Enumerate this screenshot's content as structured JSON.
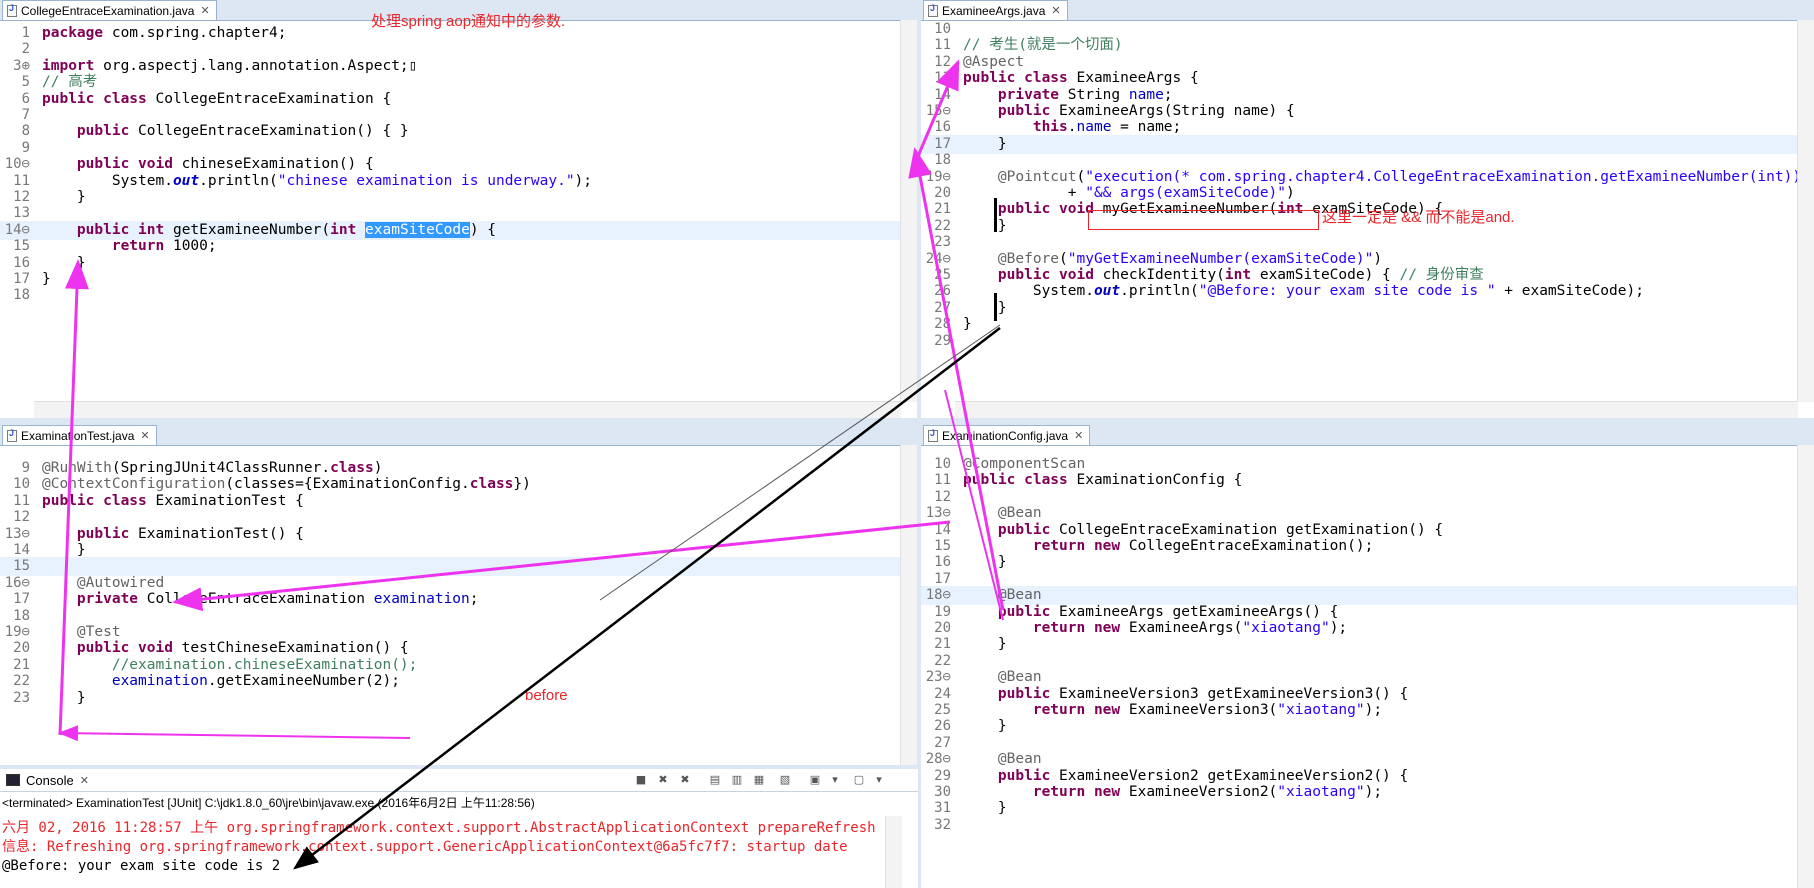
{
  "editors": {
    "college": {
      "tab": "CollegeEntraceExamination.java",
      "lines": [
        {
          "n": "1",
          "h": "<span class='kw'>package</span> com.spring.chapter4;"
        },
        {
          "n": "2",
          "h": ""
        },
        {
          "n": "3⊕",
          "h": "<span class='kw'>import</span> org.aspectj.lang.annotation.Aspect;▯"
        },
        {
          "n": "5",
          "h": "<span class='cm'>// 高考</span>"
        },
        {
          "n": "6",
          "h": "<span class='kw'>public class</span> CollegeEntraceExamination {"
        },
        {
          "n": "7",
          "h": ""
        },
        {
          "n": "8",
          "h": "    <span class='kw'>public</span> CollegeEntraceExamination() { }"
        },
        {
          "n": "9",
          "h": ""
        },
        {
          "n": "10⊖",
          "h": "    <span class='kw'>public void</span> chineseExamination() {"
        },
        {
          "n": "11",
          "h": "        System.<span class='sfld'>out</span>.println(<span class='str'>\"chinese examination is underway.\"</span>);"
        },
        {
          "n": "12",
          "h": "    }"
        },
        {
          "n": "13",
          "h": ""
        },
        {
          "n": "14⊖",
          "h": "    <span class='kw'>public int</span> getExamineeNumber(<span class='kw'>int</span> <span class='sel'>examSiteCode</span>) {",
          "hl": true
        },
        {
          "n": "15",
          "h": "        <span class='kw'>return</span> 1000;"
        },
        {
          "n": "16",
          "h": "    }"
        },
        {
          "n": "17",
          "h": "}"
        },
        {
          "n": "18",
          "h": ""
        }
      ]
    },
    "args": {
      "tab": "ExamineeArgs.java",
      "lines": [
        {
          "n": "10",
          "h": ""
        },
        {
          "n": "11",
          "h": "<span class='cm'>// 考生(就是一个切面)</span>"
        },
        {
          "n": "12",
          "h": "<span class='an'>@Aspect</span>"
        },
        {
          "n": "13",
          "h": "<span class='kw'>public class</span> ExamineeArgs {"
        },
        {
          "n": "14",
          "h": "    <span class='kw'>private</span> String <span class='fld'>name</span>;"
        },
        {
          "n": "15⊖",
          "h": "    <span class='kw'>public</span> ExamineeArgs(String name) {"
        },
        {
          "n": "16",
          "h": "        <span class='kw'>this</span>.<span class='fld'>name</span> = name;"
        },
        {
          "n": "17",
          "h": "    }",
          "hl": true
        },
        {
          "n": "18",
          "h": ""
        },
        {
          "n": "19⊖",
          "h": "    <span class='an'>@Pointcut</span>(<span class='str'>\"execution(* com.spring.chapter4.CollegeEntraceExamination.getExamineeNumber(int))\"</span>"
        },
        {
          "n": "20",
          "h": "            + <span class='str'>\"&amp;&amp; args(examSiteCode)\"</span>)"
        },
        {
          "n": "21",
          "h": "    <span class='kw'>public void</span> myGetExamineeNumber(<span class='kw'>int</span> examSiteCode) {"
        },
        {
          "n": "22",
          "h": "    }"
        },
        {
          "n": "23",
          "h": ""
        },
        {
          "n": "24⊖",
          "h": "    <span class='an'>@Before</span>(<span class='str'>\"myGetExamineeNumber(examSiteCode)\"</span>)"
        },
        {
          "n": "25",
          "h": "    <span class='kw'>public void</span> checkIdentity(<span class='kw'>int</span> examSiteCode) { <span class='cm'>// 身份审查</span>"
        },
        {
          "n": "26",
          "h": "        System.<span class='sfld'>out</span>.println(<span class='str'>\"@Before: your exam site code is \"</span> + examSiteCode);"
        },
        {
          "n": "27",
          "h": "    }"
        },
        {
          "n": "28",
          "h": "}"
        },
        {
          "n": "29",
          "h": ""
        }
      ]
    },
    "test": {
      "tab": "ExaminationTest.java",
      "lines": [
        {
          "n": "9",
          "h": "<span class='an'>@RunWith</span>(SpringJUnit4ClassRunner.<span class='kw'>class</span>)"
        },
        {
          "n": "10",
          "h": "<span class='an'>@ContextConfiguration</span>(classes={ExaminationConfig.<span class='kw'>class</span>})"
        },
        {
          "n": "11",
          "h": "<span class='kw'>public class</span> ExaminationTest {"
        },
        {
          "n": "12",
          "h": ""
        },
        {
          "n": "13⊖",
          "h": "    <span class='kw'>public</span> ExaminationTest() {"
        },
        {
          "n": "14",
          "h": "    }"
        },
        {
          "n": "15",
          "h": "",
          "hl": true
        },
        {
          "n": "16⊖",
          "h": "    <span class='an'>@Autowired</span>"
        },
        {
          "n": "17",
          "h": "    <span class='kw'>private</span> CollegeEntraceExamination <span class='fld'>examination</span>;"
        },
        {
          "n": "18",
          "h": ""
        },
        {
          "n": "19⊖",
          "h": "    <span class='an'>@Test</span>"
        },
        {
          "n": "20",
          "h": "    <span class='kw'>public void</span> testChineseExamination() {"
        },
        {
          "n": "21",
          "h": "        <span class='cm'>//examination.chineseExamination();</span>"
        },
        {
          "n": "22",
          "h": "        <span class='fld'>examination</span>.getExamineeNumber(2);"
        },
        {
          "n": "23",
          "h": "    }"
        }
      ]
    },
    "config": {
      "tab": "ExaminationConfig.java",
      "lines": [
        {
          "n": "10",
          "h": "<span class='an'>@ComponentScan</span>"
        },
        {
          "n": "11",
          "h": "<span class='kw'>public class</span> ExaminationConfig {"
        },
        {
          "n": "12",
          "h": ""
        },
        {
          "n": "13⊖",
          "h": "    <span class='an'>@Bean</span>"
        },
        {
          "n": "14",
          "h": "    <span class='kw'>public</span> CollegeEntraceExamination getExamination() {"
        },
        {
          "n": "15",
          "h": "        <span class='kw'>return new</span> CollegeEntraceExamination();"
        },
        {
          "n": "16",
          "h": "    }"
        },
        {
          "n": "17",
          "h": ""
        },
        {
          "n": "18⊖",
          "h": "    <span class='an'>@Bean</span>",
          "hl": true
        },
        {
          "n": "19",
          "h": "    <span class='kw'>public</span> ExamineeArgs getExamineeArgs() {"
        },
        {
          "n": "20",
          "h": "        <span class='kw'>return new</span> ExamineeArgs(<span class='str'>\"xiaotang\"</span>);"
        },
        {
          "n": "21",
          "h": "    }"
        },
        {
          "n": "22",
          "h": ""
        },
        {
          "n": "23⊖",
          "h": "    <span class='an'>@Bean</span>"
        },
        {
          "n": "24",
          "h": "    <span class='kw'>public</span> ExamineeVersion3 getExamineeVersion3() {"
        },
        {
          "n": "25",
          "h": "        <span class='kw'>return new</span> ExamineeVersion3(<span class='str'>\"xiaotang\"</span>);"
        },
        {
          "n": "26",
          "h": "    }"
        },
        {
          "n": "27",
          "h": ""
        },
        {
          "n": "28⊖",
          "h": "    <span class='an'>@Bean</span>"
        },
        {
          "n": "29",
          "h": "    <span class='kw'>public</span> ExamineeVersion2 getExamineeVersion2() {"
        },
        {
          "n": "30",
          "h": "        <span class='kw'>return new</span> ExamineeVersion2(<span class='str'>\"xiaotang\"</span>);"
        },
        {
          "n": "31",
          "h": "    }"
        },
        {
          "n": "32",
          "h": ""
        }
      ]
    }
  },
  "notes": {
    "title": "处理spring aop通知中的参数.",
    "and_note": "这里一定是 && 而不能是and.",
    "before": "before"
  },
  "console": {
    "tab": "Console",
    "terminated": "<terminated> ExaminationTest [JUnit] C:\\jdk1.8.0_60\\jre\\bin\\javaw.exe (2016年6月2日 上午11:28:56)",
    "line1": "六月 02, 2016 11:28:57 上午 org.springframework.context.support.AbstractApplicationContext prepareRefresh",
    "line2": "信息: Refreshing org.springframework.context.support.GenericApplicationContext@6a5fc7f7: startup date",
    "line3": "@Before: your exam site code is 2"
  },
  "colors": {
    "arrow_magenta": "#ee33ee",
    "note_red": "#e8262b"
  }
}
